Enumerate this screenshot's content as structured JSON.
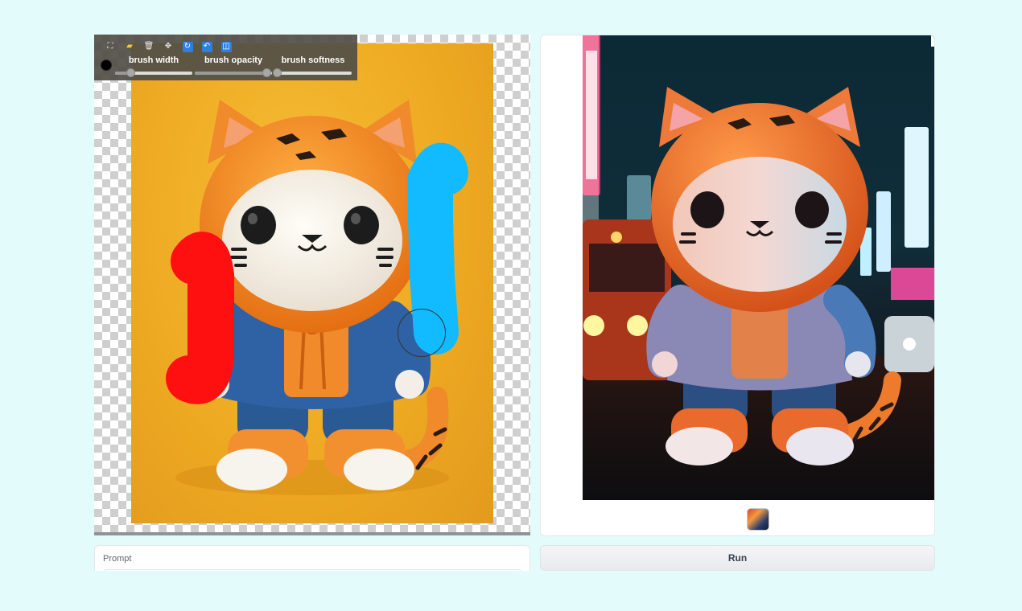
{
  "toolbar": {
    "tools": [
      {
        "name": "fullscreen-icon",
        "glyph": "⛶"
      },
      {
        "name": "open-folder-icon",
        "glyph": "▰"
      },
      {
        "name": "trash-icon",
        "glyph": "🗑"
      },
      {
        "name": "move-icon",
        "glyph": "✥"
      },
      {
        "name": "refresh-icon",
        "glyph": "↻"
      },
      {
        "name": "undo-icon",
        "glyph": "↶"
      },
      {
        "name": "crop-icon",
        "glyph": "◫"
      }
    ],
    "brush_color": "#000000",
    "sliders": {
      "width": {
        "label": "brush width",
        "value": 0.2
      },
      "opacity": {
        "label": "brush opacity",
        "value": 0.93
      },
      "softness": {
        "label": "brush softness",
        "value": 0.03
      }
    }
  },
  "canvas": {
    "stroke_colors": [
      "#ff1010",
      "#12bbff"
    ]
  },
  "prompt": {
    "label": "Prompt",
    "value": ""
  },
  "run": {
    "label": "Run"
  }
}
